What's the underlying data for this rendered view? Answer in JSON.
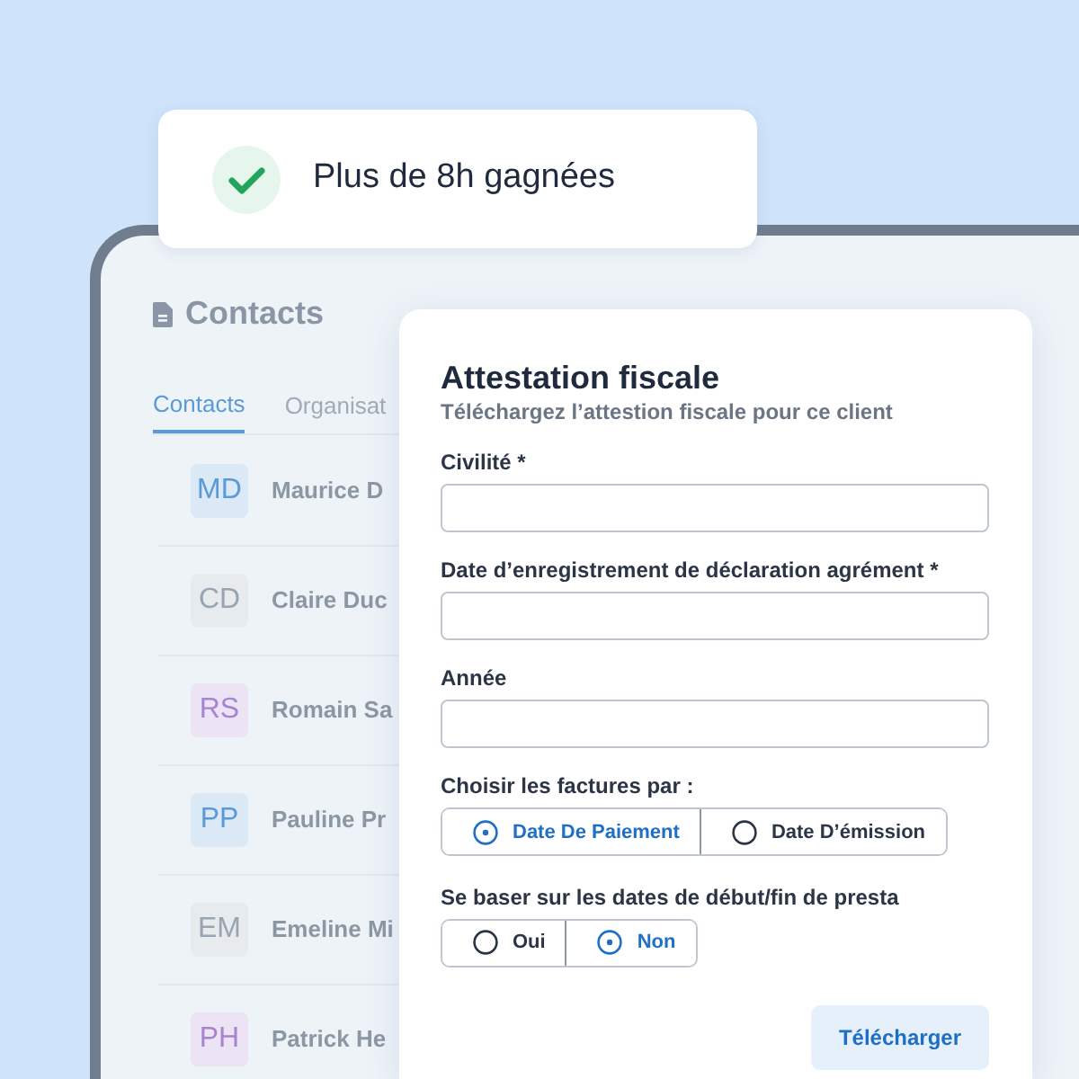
{
  "toast": {
    "text": "Plus de 8h gagnées"
  },
  "contacts": {
    "title": "Contacts",
    "tabs": [
      {
        "label": "Contacts",
        "selected": true
      },
      {
        "label": "Organisat",
        "selected": false
      }
    ],
    "rows": [
      {
        "initials": "MD",
        "name": "Maurice D",
        "color": "#5b9ad8"
      },
      {
        "initials": "CD",
        "name": "Claire Duc",
        "color": "#98a4b1"
      },
      {
        "initials": "RS",
        "name": "Romain Sa",
        "color": "#a784cf"
      },
      {
        "initials": "PP",
        "name": "Pauline Pr",
        "color": "#5b9ad8"
      },
      {
        "initials": "EM",
        "name": "Emeline Mi",
        "color": "#98a4b1"
      },
      {
        "initials": "PH",
        "name": "Patrick He",
        "color": "#a784cf"
      }
    ]
  },
  "modal": {
    "title": "Attestation fiscale",
    "subtitle": "Téléchargez l’attestion fiscale pour ce client",
    "fields": [
      {
        "label": "Civilité *"
      },
      {
        "label": "Date d’enregistrement de déclaration agrément *"
      },
      {
        "label": "Année"
      }
    ],
    "choices": [
      {
        "label": "Choisir les factures par :",
        "options": [
          {
            "label": "Date De Paiement",
            "selected": true
          },
          {
            "label": "Date D’émission",
            "selected": false
          }
        ]
      },
      {
        "label": "Se baser sur les dates de début/fin de presta",
        "options": [
          {
            "label": "Oui",
            "selected": false
          },
          {
            "label": "Non",
            "selected": true
          }
        ]
      }
    ],
    "button": "Télécharger"
  }
}
